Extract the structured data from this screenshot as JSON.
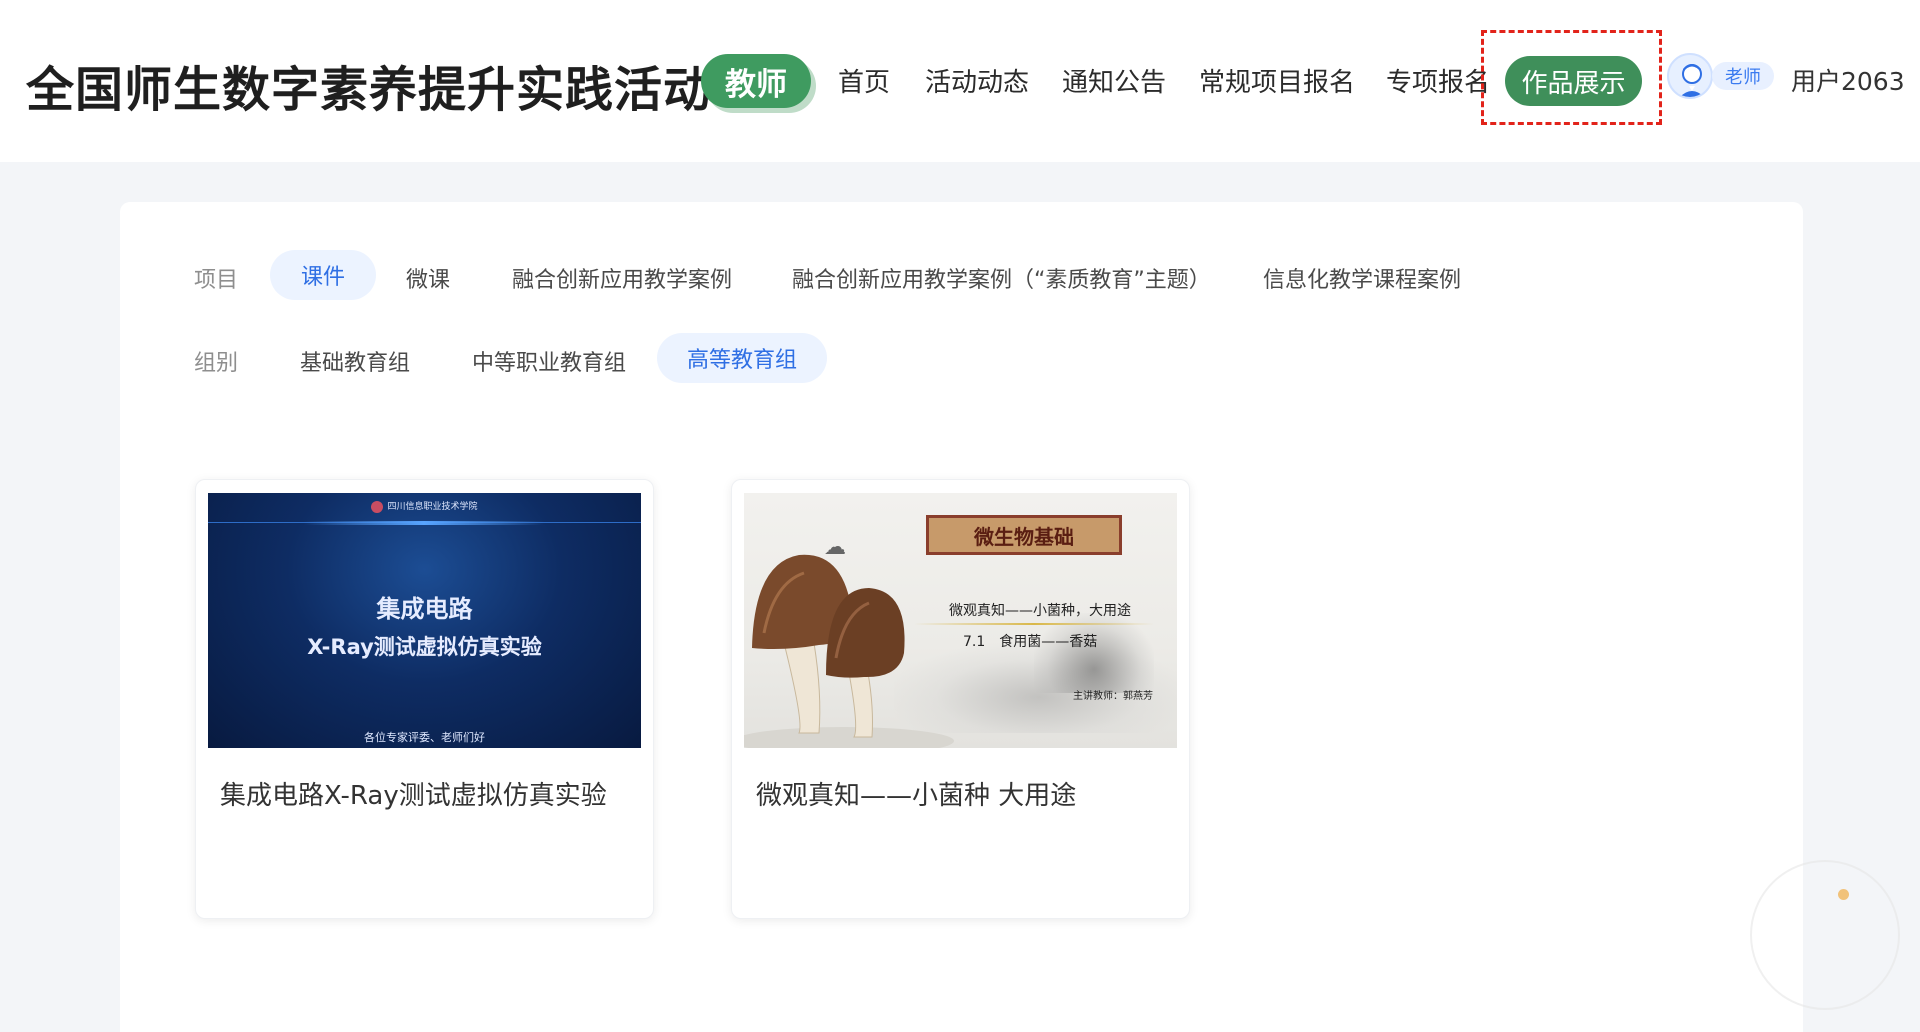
{
  "header": {
    "site_title": "全国师生数字素养提升实践活动",
    "role_badge": "教师",
    "nav": [
      {
        "label": "首页"
      },
      {
        "label": "活动动态"
      },
      {
        "label": "通知公告"
      },
      {
        "label": "常规项目报名"
      },
      {
        "label": "专项报名"
      },
      {
        "label": "作品展示",
        "active": true
      }
    ],
    "user": {
      "role_tag": "老师",
      "name": "用户2063"
    }
  },
  "filters": {
    "project": {
      "label": "项目",
      "options": [
        {
          "label": "课件",
          "selected": true
        },
        {
          "label": "微课"
        },
        {
          "label": "融合创新应用教学案例"
        },
        {
          "label": "融合创新应用教学案例（“素质教育”主题）"
        },
        {
          "label": "信息化教学课程案例"
        }
      ]
    },
    "group": {
      "label": "组别",
      "options": [
        {
          "label": "基础教育组"
        },
        {
          "label": "中等职业教育组"
        },
        {
          "label": "高等教育组",
          "selected": true
        }
      ]
    }
  },
  "cards": [
    {
      "title": "集成电路X-Ray测试虚拟仿真实验",
      "thumbnail": {
        "school": "四川信息职业技术学院",
        "title_line1": "集成电路",
        "title_line2": "X-Ray测试虚拟仿真实验",
        "footer": "各位专家评委、老师们好"
      }
    },
    {
      "title": "微观真知——小菌种 大用途",
      "thumbnail": {
        "banner": "微生物基础",
        "line1": "微观真知——小菌种，大用途",
        "line2": "7.1　食用菌——香菇",
        "line3": "主讲教师：郭燕芳"
      }
    }
  ],
  "colors": {
    "brand_green": "#3f8f5a",
    "accent_blue": "#2f6fe4",
    "highlight_red": "#e2231a"
  }
}
